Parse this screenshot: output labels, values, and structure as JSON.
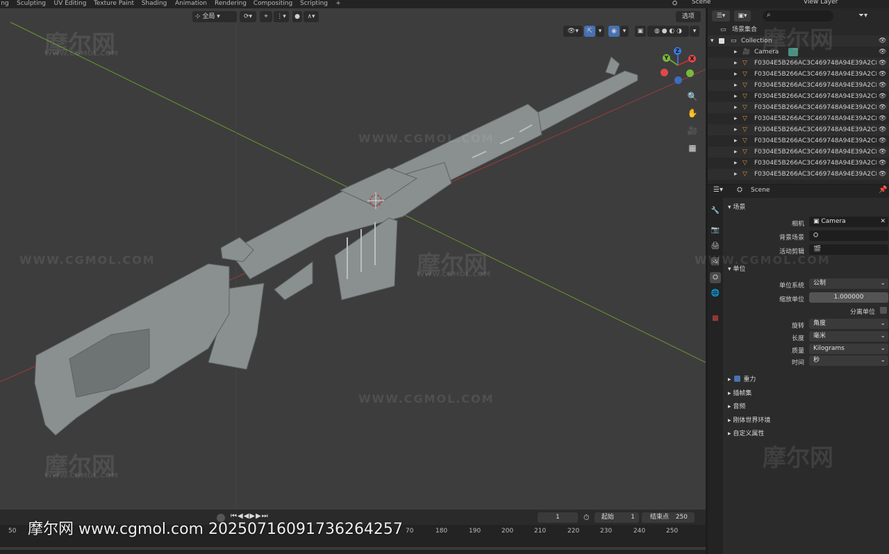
{
  "workspace_tabs": [
    "ng",
    "Sculpting",
    "UV Editing",
    "Texture Paint",
    "Shading",
    "Animation",
    "Rendering",
    "Compositing",
    "Scripting",
    "+"
  ],
  "scene_selector": "Scene",
  "view_layer": "View Layer",
  "viewport_header": {
    "transform_orientation": "全局",
    "options_label": "选项"
  },
  "navigation_gizmo": {
    "z": "Z",
    "y": "Y",
    "x": "X"
  },
  "outliner": {
    "search_placeholder": "",
    "root": "场景集合",
    "collection": "Collection",
    "camera": "Camera",
    "objects": [
      "F0304E5B266AC3C469748A94E39A2C8(",
      "F0304E5B266AC3C469748A94E39A2C8(",
      "F0304E5B266AC3C469748A94E39A2C8(",
      "F0304E5B266AC3C469748A94E39A2C8(",
      "F0304E5B266AC3C469748A94E39A2C8(",
      "F0304E5B266AC3C469748A94E39A2C8(",
      "F0304E5B266AC3C469748A94E39A2C8(",
      "F0304E5B266AC3C469748A94E39A2C8(",
      "F0304E5B266AC3C469748A94E39A2C8(",
      "F0304E5B266AC3C469748A94E39A2C8(",
      "F0304E5B266AC3C469748A94E39A2C8("
    ]
  },
  "properties": {
    "header_scene": "Scene",
    "scene_section": "场景",
    "camera_label": "相机",
    "camera_value": "Camera",
    "background_scene_label": "背景场景",
    "active_clip_label": "活动剪辑",
    "units_section": "单位",
    "unit_system_label": "单位系统",
    "unit_system_value": "公制",
    "unit_scale_label": "缩放单位",
    "unit_scale_value": "1.000000",
    "separate_units_label": "分离单位",
    "rotation_label": "旋转",
    "rotation_value": "角度",
    "length_label": "长度",
    "length_value": "毫米",
    "mass_label": "质量",
    "mass_value": "Kilograms",
    "time_label": "时间",
    "time_value": "秒",
    "gravity_label": "重力",
    "keying_sets_label": "插帧集",
    "audio_label": "音频",
    "rigid_body_label": "刚体世界环境",
    "custom_props_label": "自定义属性"
  },
  "timeline": {
    "current_frame": "1",
    "start_label": "起始",
    "start_value": "1",
    "end_label": "结束点",
    "end_value": "250",
    "ticks": [
      "50",
      "70",
      "180",
      "190",
      "200",
      "210",
      "220",
      "230",
      "240",
      "250"
    ]
  },
  "watermark": {
    "brand": "摩尔网",
    "site": "WWW.CGMOL.COM",
    "site_small": "WWW.CGMOL.COM",
    "footer": "摩尔网 www.cgmol.com 20250716091736264257"
  },
  "colors": {
    "accent": "#4772b3",
    "x_axis": "#b03a3a",
    "y_axis": "#6a9a2a",
    "model": "#8a9090"
  }
}
